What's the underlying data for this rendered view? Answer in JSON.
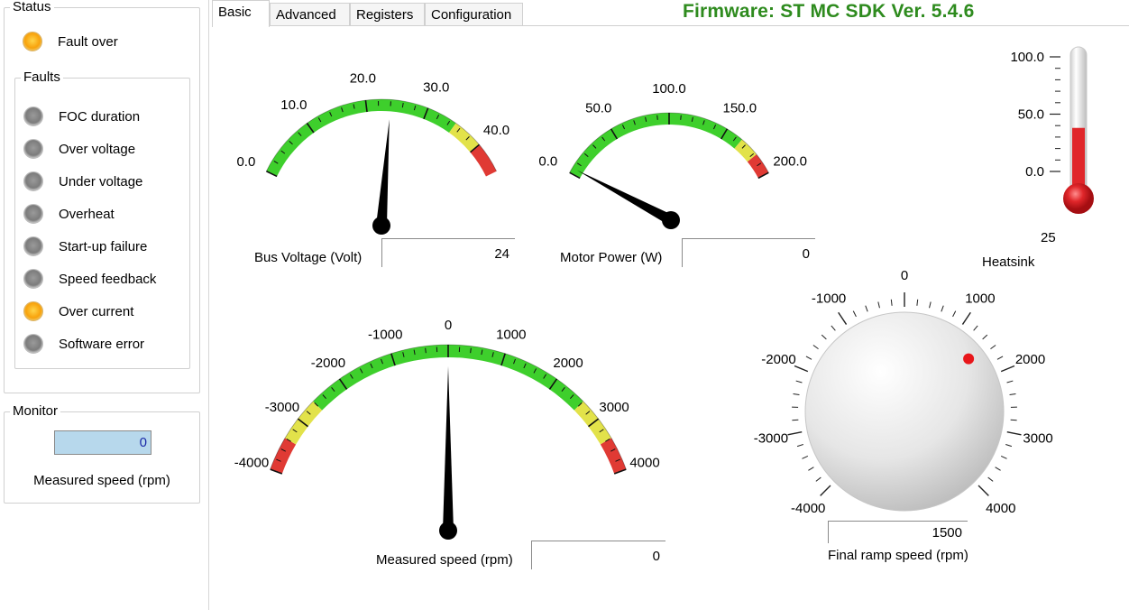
{
  "status": {
    "title": "Status",
    "fault_over": {
      "label": "Fault over",
      "state": "on"
    }
  },
  "faults": {
    "title": "Faults",
    "items": [
      {
        "label": "FOC duration",
        "state": "off"
      },
      {
        "label": "Over voltage",
        "state": "off"
      },
      {
        "label": "Under voltage",
        "state": "off"
      },
      {
        "label": "Overheat",
        "state": "off"
      },
      {
        "label": "Start-up failure",
        "state": "off"
      },
      {
        "label": "Speed feedback",
        "state": "off"
      },
      {
        "label": "Over current",
        "state": "on"
      },
      {
        "label": "Software error",
        "state": "off"
      }
    ]
  },
  "monitor": {
    "title": "Monitor",
    "value": "0",
    "label": "Measured speed (rpm)"
  },
  "tabs": [
    "Basic",
    "Advanced",
    "Registers",
    "Configuration"
  ],
  "active_tab": "Basic",
  "firmware": "Firmware: ST MC SDK Ver. 5.4.6",
  "gauges": {
    "bus_voltage": {
      "label": "Bus Voltage (Volt)",
      "readout": "24",
      "ticks": [
        "0.0",
        "10.0",
        "20.0",
        "30.0",
        "40.0"
      ],
      "value": 24,
      "min": 0,
      "max": 45
    },
    "motor_power": {
      "label": "Motor Power (W)",
      "readout": "0",
      "ticks": [
        "0.0",
        "50.0",
        "100.0",
        "150.0",
        "200.0"
      ],
      "value": 0,
      "min": 0,
      "max": 200
    },
    "measured_speed": {
      "label": "Measured speed (rpm)",
      "readout": "0",
      "ticks": [
        "-4000",
        "-3000",
        "-2000",
        "-1000",
        "0",
        "1000",
        "2000",
        "3000",
        "4000"
      ],
      "value": 0,
      "min": -4000,
      "max": 4000
    }
  },
  "heatsink": {
    "label": "Heatsink",
    "value": "25",
    "ticks": [
      "100.0",
      "50.0",
      "0.0"
    ],
    "level": 25
  },
  "knob": {
    "label": "Final ramp speed (rpm)",
    "value": "1500",
    "ticks": [
      "0",
      "1000",
      "2000",
      "3000",
      "4000",
      "-4000",
      "-3000",
      "-2000",
      "-1000"
    ],
    "level": 1500
  },
  "colors": {
    "firmware": "#2e8b1e",
    "led_on": "#f8a20c",
    "led_off": "#7c7c7c",
    "zone_green": "#3ecf2c",
    "zone_yellow": "#e2e24a",
    "zone_red": "#e03a34",
    "thermo_red": "#e0262a",
    "knob_dot": "#e8161a"
  }
}
